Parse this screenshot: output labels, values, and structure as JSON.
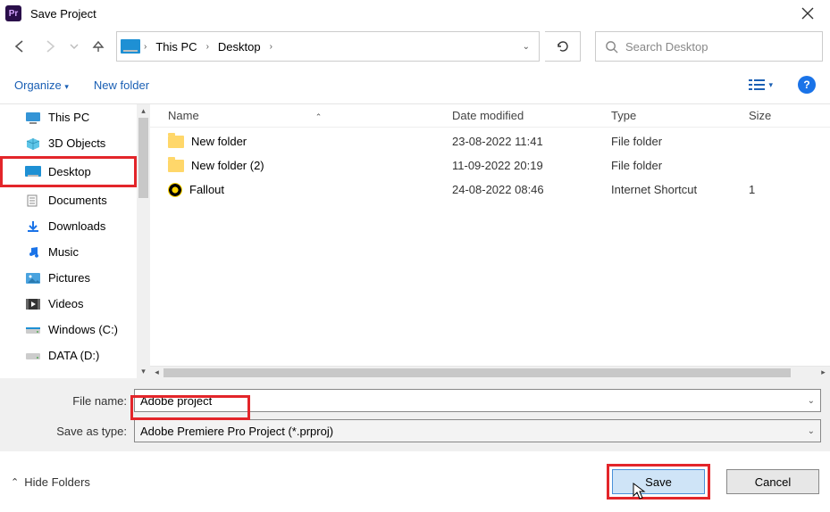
{
  "window": {
    "app_icon_text": "Pr",
    "title": "Save Project"
  },
  "breadcrumbs": {
    "root": "This PC",
    "leaf": "Desktop"
  },
  "search": {
    "placeholder": "Search Desktop"
  },
  "toolbar": {
    "organize": "Organize",
    "newfolder": "New folder"
  },
  "sidebar": {
    "items": [
      {
        "label": "This PC"
      },
      {
        "label": "3D Objects"
      },
      {
        "label": "Desktop"
      },
      {
        "label": "Documents"
      },
      {
        "label": "Downloads"
      },
      {
        "label": "Music"
      },
      {
        "label": "Pictures"
      },
      {
        "label": "Videos"
      },
      {
        "label": "Windows (C:)"
      },
      {
        "label": "DATA (D:)"
      }
    ]
  },
  "columns": {
    "name": "Name",
    "date": "Date modified",
    "type": "Type",
    "size": "Size"
  },
  "files": [
    {
      "name": "New folder",
      "date": "23-08-2022 11:41",
      "type": "File folder",
      "icon": "folder",
      "size": ""
    },
    {
      "name": "New folder (2)",
      "date": "11-09-2022 20:19",
      "type": "File folder",
      "icon": "folder",
      "size": ""
    },
    {
      "name": "Fallout",
      "date": "24-08-2022 08:46",
      "type": "Internet Shortcut",
      "icon": "shortcut",
      "size": "1"
    }
  ],
  "form": {
    "file_name_label": "File name:",
    "file_name_value": "Adobe project",
    "save_type_label": "Save as type:",
    "save_type_value": "Adobe Premiere Pro Project (*.prproj)"
  },
  "buttons": {
    "hide_folders": "Hide Folders",
    "save": "Save",
    "cancel": "Cancel"
  }
}
